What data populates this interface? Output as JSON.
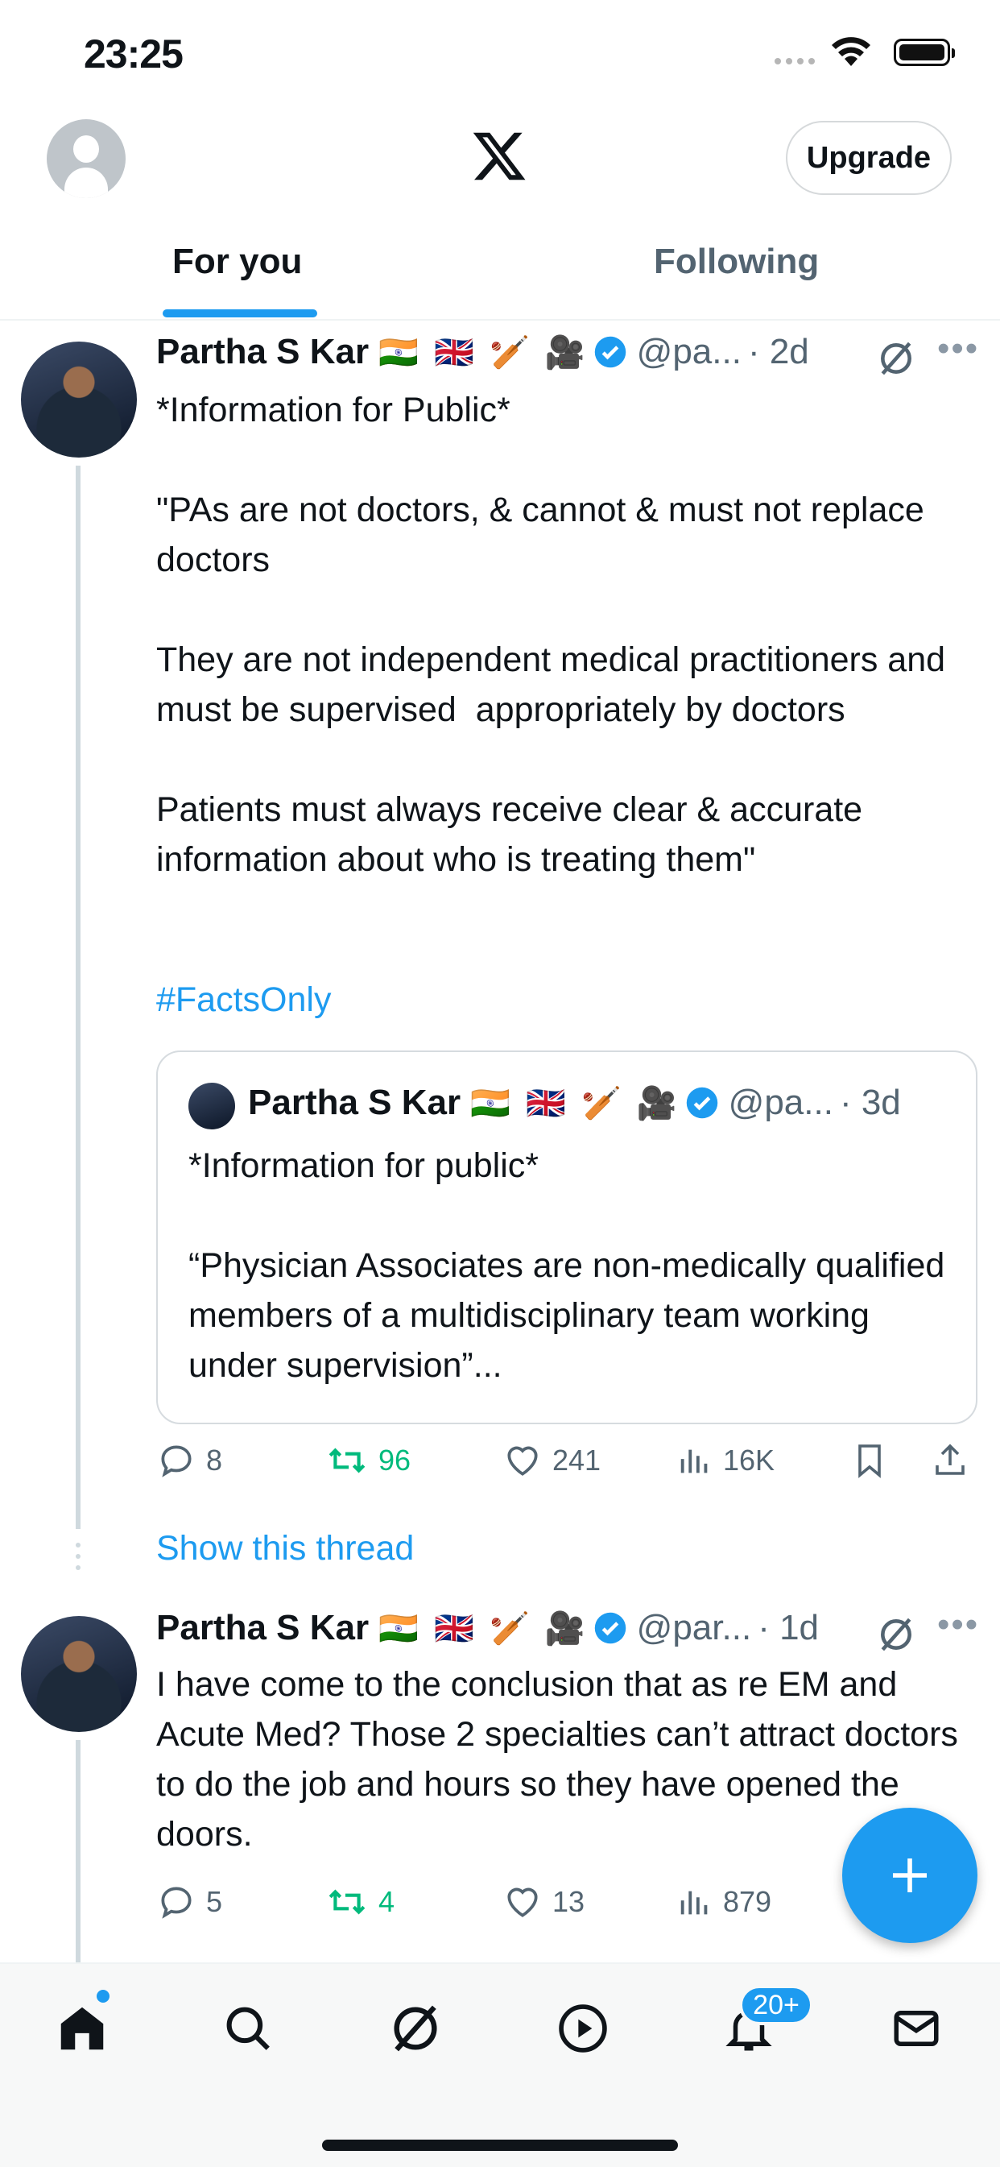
{
  "status": {
    "time": "23:25"
  },
  "header": {
    "upgrade_label": "Upgrade"
  },
  "tabs": [
    {
      "label": "For you"
    },
    {
      "label": "Following"
    }
  ],
  "posts": [
    {
      "name": "Partha S Kar",
      "flags": "🇮🇳 🇬🇧 🏏 🎥",
      "handle": "@pa...",
      "time": "· 2d",
      "text": "*Information for Public*\n\n\"PAs are not doctors, & cannot & must not replace doctors\n\nThey are not independent medical practitioners and must be supervised  appropriately by doctors\n\nPatients must always receive clear & accurate information about who is treating them\"",
      "hashtag": "#FactsOnly",
      "quote": {
        "name": "Partha S Kar",
        "flags": "🇮🇳 🇬🇧 🏏 🎥",
        "handle": "@pa...",
        "time": "· 3d",
        "text": "*Information for public*\n\n“Physician Associates are non-medically qualified members of a multidisciplinary team working under supervision”..."
      },
      "stats": {
        "replies": "8",
        "reposts": "96",
        "likes": "241",
        "views": "16K"
      },
      "show_thread": "Show this thread"
    },
    {
      "name": "Partha S Kar",
      "flags": "🇮🇳 🇬🇧 🏏 🎥",
      "handle": "@par...",
      "time": "· 1d",
      "text": "I have come to the conclusion that as re EM and Acute Med? Those 2 specialties can’t attract doctors to do the job and hours so they have opened the doors.",
      "stats": {
        "replies": "5",
        "reposts": "4",
        "likes": "13",
        "views": "879"
      }
    }
  ],
  "nav": {
    "notifications_badge": "20+"
  },
  "colors": {
    "accent": "#1d9bf0",
    "repost": "#00ba7c",
    "secondary": "#536471"
  }
}
